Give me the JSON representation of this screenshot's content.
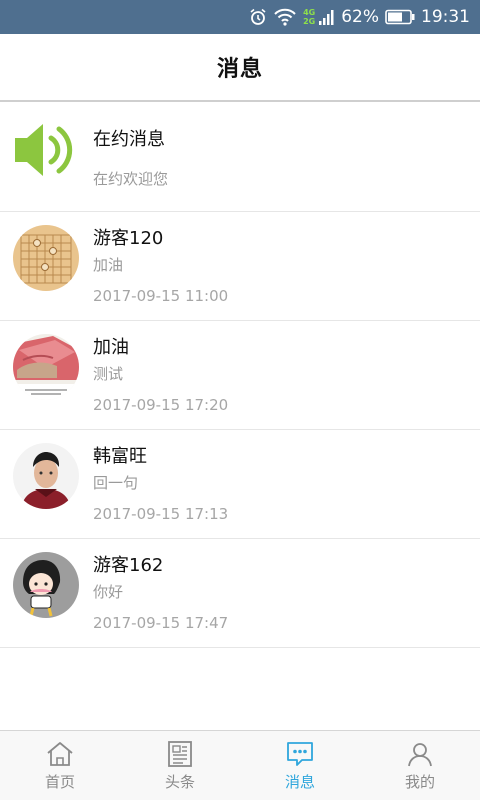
{
  "status_bar": {
    "net_4g": "4G",
    "net_2g": "2G",
    "battery": "62%",
    "time": "19:31"
  },
  "header": {
    "title": "消息"
  },
  "messages": [
    {
      "name": "在约消息",
      "preview": "在约欢迎您",
      "time": "",
      "avatar": "speaker-icon"
    },
    {
      "name": "游客120",
      "preview": "加油",
      "time": "2017-09-15 11:00",
      "avatar": "chessboard-avatar"
    },
    {
      "name": "加油",
      "preview": "测试",
      "time": "2017-09-15 17:20",
      "avatar": "money-photo-avatar"
    },
    {
      "name": "韩富旺",
      "preview": "回一句",
      "time": "2017-09-15 17:13",
      "avatar": "portrait-photo-avatar"
    },
    {
      "name": "游客162",
      "preview": "你好",
      "time": "2017-09-15 17:47",
      "avatar": "cartoon-girl-avatar"
    }
  ],
  "tabs": [
    {
      "label": "首页",
      "icon": "home-icon",
      "active": false
    },
    {
      "label": "头条",
      "icon": "news-icon",
      "active": false
    },
    {
      "label": "消息",
      "icon": "message-icon",
      "active": true
    },
    {
      "label": "我的",
      "icon": "profile-icon",
      "active": false
    }
  ],
  "colors": {
    "status_bar": "#4f6f8f",
    "accent": "#2fa6dc",
    "speaker": "#8cc63f"
  }
}
